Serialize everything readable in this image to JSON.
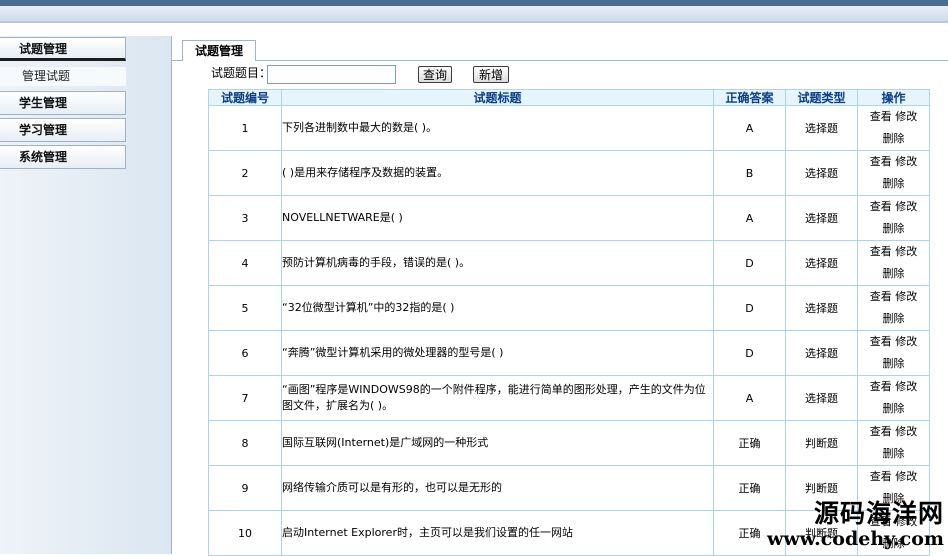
{
  "sidebar": {
    "menu": [
      {
        "label": "试题管理",
        "active": true
      },
      {
        "label": "学生管理"
      },
      {
        "label": "学习管理"
      },
      {
        "label": "系统管理"
      }
    ],
    "sub_item": "管理试题"
  },
  "tab": {
    "label": "试题管理"
  },
  "search": {
    "label": "试题题目：",
    "value": "",
    "placeholder": "",
    "query_button": "查询",
    "add_button": "新增"
  },
  "table": {
    "headers": [
      "试题编号",
      "试题标题",
      "正确答案",
      "试题类型",
      "操作"
    ],
    "ops": {
      "view": "查看",
      "edit": "修改",
      "delete": "删除"
    },
    "rows": [
      {
        "id": "1",
        "title": "下列各进制数中最大的数是( )。",
        "answer": "A",
        "type": "选择题"
      },
      {
        "id": "2",
        "title": "( )是用来存储程序及数据的装置。",
        "answer": "B",
        "type": "选择题"
      },
      {
        "id": "3",
        "title": "NOVELLNETWARE是( )",
        "answer": "A",
        "type": "选择题"
      },
      {
        "id": "4",
        "title": "预防计算机病毒的手段，错误的是( )。",
        "answer": "D",
        "type": "选择题"
      },
      {
        "id": "5",
        "title": "“32位微型计算机”中的32指的是( )",
        "answer": "D",
        "type": "选择题"
      },
      {
        "id": "6",
        "title": "“奔腾”微型计算机采用的微处理器的型号是( )",
        "answer": "D",
        "type": "选择题"
      },
      {
        "id": "7",
        "title": "“画图”程序是WINDOWS98的一个附件程序，能进行简单的图形处理，产生的文件为位图文件，扩展名为( )。",
        "answer": "A",
        "type": "选择题"
      },
      {
        "id": "8",
        "title": "国际互联网(Internet)是广域网的一种形式",
        "answer": "正确",
        "type": "判断题"
      },
      {
        "id": "9",
        "title": "网络传输介质可以是有形的，也可以是无形的",
        "answer": "正确",
        "type": "判断题"
      },
      {
        "id": "10",
        "title": "启动Internet Explorer时，主页可以是我们设置的任一网站",
        "answer": "正确",
        "type": "判断题"
      }
    ]
  },
  "watermark": {
    "line1": "源码海洋网",
    "line2": "www.codehy.com"
  }
}
